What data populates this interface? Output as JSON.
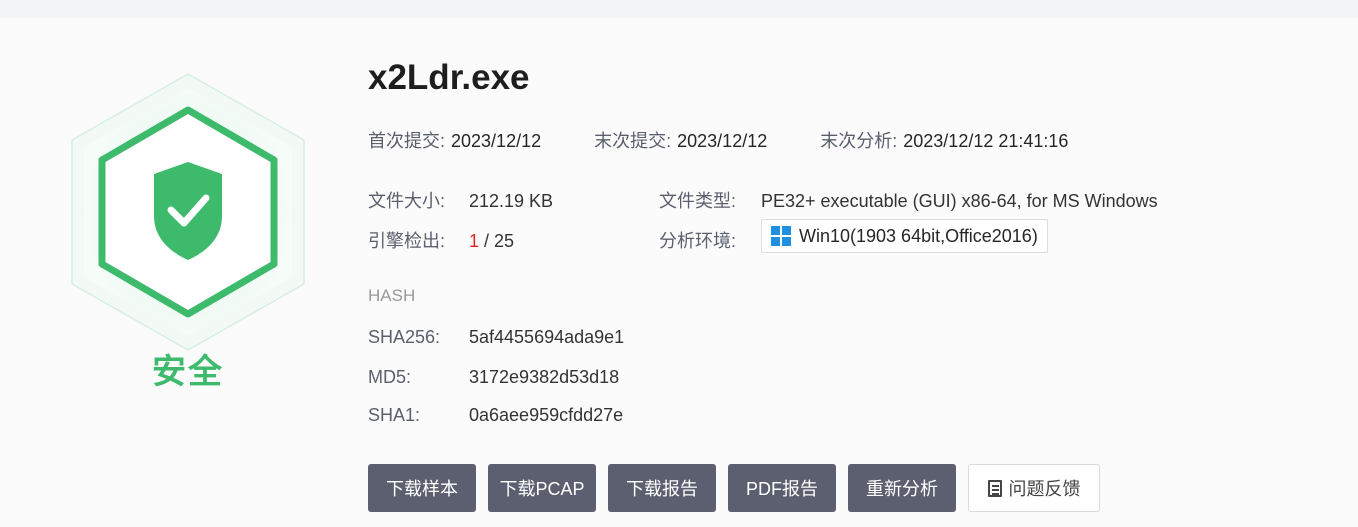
{
  "file": {
    "name": "x2Ldr.exe",
    "verdict": "安全",
    "first_submit_label": "首次提交:",
    "first_submit_value": "2023/12/12",
    "last_submit_label": "末次提交:",
    "last_submit_value": "2023/12/12",
    "last_analysis_label": "末次分析:",
    "last_analysis_value": "2023/12/12 21:41:16",
    "size_label": "文件大小:",
    "size_value": "212.19 KB",
    "type_label": "文件类型:",
    "type_value": "PE32+ executable (GUI) x86-64, for MS Windows",
    "engine_label": "引擎检出:",
    "engine_detected": "1",
    "engine_total": " / 25",
    "env_label": "分析环境:",
    "env_value": "Win10(1903 64bit,Office2016)"
  },
  "hash": {
    "heading": "HASH",
    "sha256_label": "SHA256:",
    "sha256_value": "5af4455694ada9e1",
    "md5_label": "MD5:",
    "md5_value": "3172e9382d53d18",
    "sha1_label": "SHA1:",
    "sha1_value": "0a6aee959cfdd27e"
  },
  "actions": {
    "download_sample": "下载样本",
    "download_pcap": "下载PCAP",
    "download_report": "下载报告",
    "pdf_report": "PDF报告",
    "reanalyze": "重新分析",
    "feedback": "问题反馈"
  },
  "colors": {
    "safe_green": "#3dba6b",
    "detected_red": "#e02424",
    "button_dark": "#5b5f70",
    "windows_blue": "#1e8fe1"
  },
  "icons": {
    "shield": "shield-check-icon",
    "windows": "windows-icon",
    "feedback": "document-icon"
  }
}
